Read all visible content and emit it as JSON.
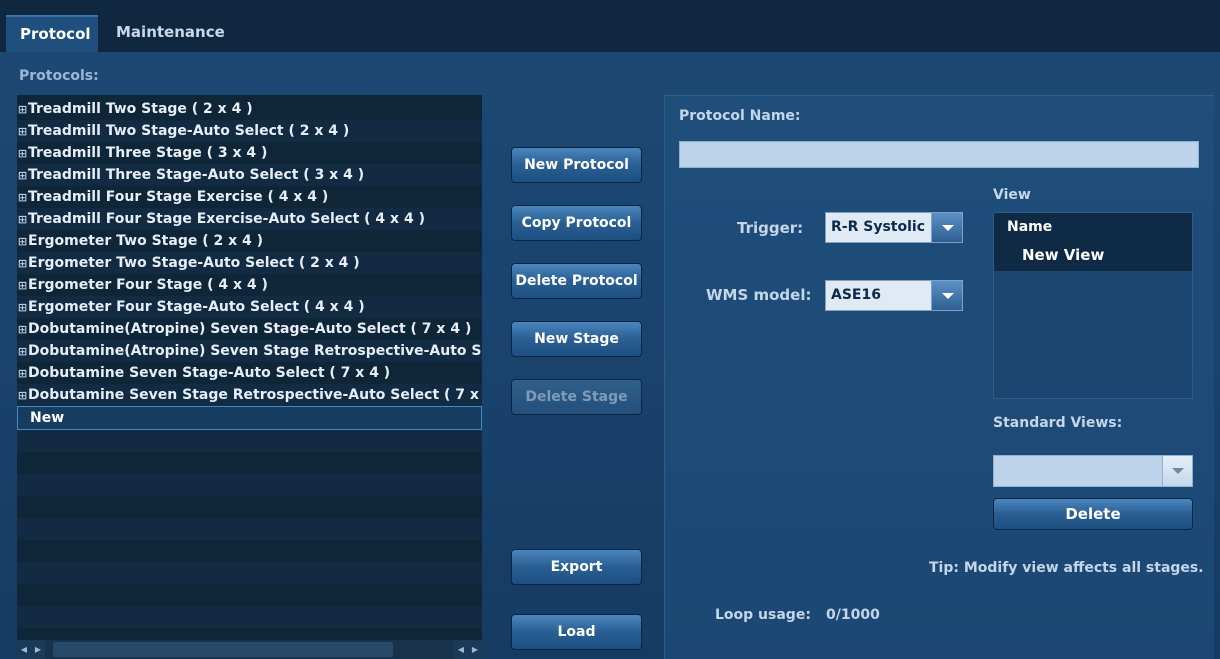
{
  "tabs": [
    {
      "label": "Protocol",
      "active": true
    },
    {
      "label": "Maintenance",
      "active": false
    }
  ],
  "protocols": {
    "label": "Protocols:",
    "items": [
      "Treadmill Two Stage ( 2 x 4 )",
      "Treadmill Two Stage-Auto Select ( 2 x 4 )",
      "Treadmill Three Stage ( 3 x 4 )",
      "Treadmill Three Stage-Auto Select ( 3 x 4 )",
      "Treadmill Four Stage Exercise ( 4 x 4 )",
      "Treadmill Four Stage Exercise-Auto Select ( 4 x 4 )",
      "Ergometer Two Stage ( 2 x 4 )",
      "Ergometer Two Stage-Auto Select ( 2 x 4 )",
      "Ergometer Four Stage ( 4 x 4 )",
      "Ergometer Four Stage-Auto Select ( 4 x 4 )",
      "Dobutamine(Atropine) Seven Stage-Auto Select ( 7 x 4 )",
      "Dobutamine(Atropine) Seven Stage Retrospective-Auto S",
      "Dobutamine Seven Stage-Auto Select ( 7 x 4 )",
      "Dobutamine Seven Stage Retrospective-Auto Select ( 7 x"
    ],
    "selected_item": "New",
    "expand_glyph": "⊞"
  },
  "buttons": {
    "new_protocol": "New Protocol",
    "copy_protocol": "Copy Protocol",
    "delete_protocol": "Delete Protocol",
    "new_stage": "New Stage",
    "delete_stage": "Delete Stage",
    "export": "Export",
    "load": "Load",
    "delete": "Delete"
  },
  "form": {
    "protocol_name_label": "Protocol Name:",
    "protocol_name_value": "",
    "trigger_label": "Trigger:",
    "trigger_value": "R-R Systolic",
    "wms_label": "WMS model:",
    "wms_value": "ASE16",
    "view_label": "View",
    "view_column_header": "Name",
    "views": [
      "New View"
    ],
    "standard_views_label": "Standard Views:",
    "standard_views_value": "",
    "tip": "Tip: Modify view affects all stages.",
    "loop_usage_label": "Loop usage:",
    "loop_usage_value": "0/1000"
  }
}
